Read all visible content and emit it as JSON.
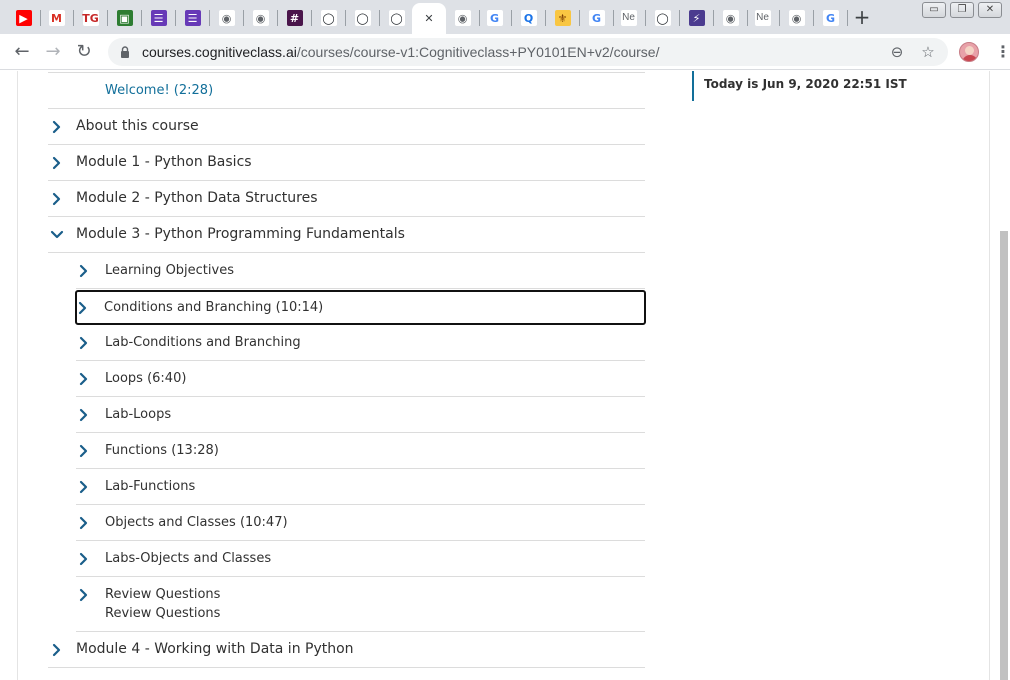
{
  "browser": {
    "tabs": [
      {
        "icon": "youtube-icon",
        "glyph": "▶",
        "color": "#ff0000",
        "text_color": "#ffffff"
      },
      {
        "icon": "gmail-icon",
        "glyph": "M",
        "color": "#ffffff",
        "text_color": "#d93025"
      },
      {
        "icon": "tg-icon",
        "glyph": "TG",
        "color": "#ffffff",
        "text_color": "#c62828"
      },
      {
        "icon": "contacts-icon",
        "glyph": "▣",
        "color": "#2e7d32",
        "text_color": "#ffffff"
      },
      {
        "icon": "forms-icon",
        "glyph": "☰",
        "color": "#673ab7",
        "text_color": "#ffffff"
      },
      {
        "icon": "forms-icon",
        "glyph": "☰",
        "color": "#673ab7",
        "text_color": "#ffffff"
      },
      {
        "icon": "globe-icon",
        "glyph": "◉",
        "color": "#ffffff",
        "text_color": "#5f6368"
      },
      {
        "icon": "globe-icon",
        "glyph": "◉",
        "color": "#ffffff",
        "text_color": "#5f6368"
      },
      {
        "icon": "slack-icon",
        "glyph": "#",
        "color": "#4a154b",
        "text_color": "#ffffff"
      },
      {
        "icon": "github-icon",
        "glyph": "◯",
        "color": "#ffffff",
        "text_color": "#24292e"
      },
      {
        "icon": "github-icon",
        "glyph": "◯",
        "color": "#ffffff",
        "text_color": "#24292e"
      },
      {
        "icon": "github-icon",
        "glyph": "◯",
        "color": "#ffffff",
        "text_color": "#24292e"
      },
      {
        "icon": "close-icon",
        "glyph": "✕",
        "color": "#ffffff",
        "text_color": "#3c4043",
        "active": true
      },
      {
        "icon": "globe-icon",
        "glyph": "◉",
        "color": "#ffffff",
        "text_color": "#5f6368"
      },
      {
        "icon": "google-icon",
        "glyph": "G",
        "color": "#ffffff",
        "text_color": "#4285f4"
      },
      {
        "icon": "quora-icon",
        "glyph": "Q",
        "color": "#ffffff",
        "text_color": "#1a73e8"
      },
      {
        "icon": "badge-icon",
        "glyph": "⚜",
        "color": "#f9c642",
        "text_color": "#7a3b00"
      },
      {
        "icon": "google-icon",
        "glyph": "G",
        "color": "#ffffff",
        "text_color": "#4285f4"
      },
      {
        "icon": "new-tab-icon",
        "text": "Ne",
        "color": "#ffffff",
        "text_color": "#5f6368"
      },
      {
        "icon": "github-icon",
        "glyph": "◯",
        "color": "#ffffff",
        "text_color": "#24292e"
      },
      {
        "icon": "lightning-icon",
        "glyph": "⚡",
        "color": "#4b3b8f",
        "text_color": "#ffffff"
      },
      {
        "icon": "globe-icon",
        "glyph": "◉",
        "color": "#ffffff",
        "text_color": "#5f6368"
      },
      {
        "icon": "new-tab-icon",
        "text": "Ne",
        "color": "#ffffff",
        "text_color": "#5f6368"
      },
      {
        "icon": "globe-icon",
        "glyph": "◉",
        "color": "#ffffff",
        "text_color": "#5f6368"
      },
      {
        "icon": "google-icon",
        "glyph": "G",
        "color": "#ffffff",
        "text_color": "#4285f4"
      }
    ],
    "new_tab_glyph": "+",
    "window_controls": {
      "minimize": "▭",
      "restore": "❐",
      "close": "✕"
    },
    "nav": {
      "back": "←",
      "forward": "→",
      "reload": "↻"
    },
    "url_host": "courses.cognitiveclass.ai",
    "url_path": "/courses/course-v1:Cognitiveclass+PY0101EN+v2/course/",
    "zoom_glyph": "⊖",
    "star_glyph": "☆",
    "menu_glyph": "⋮"
  },
  "course": {
    "welcome_link": "Welcome! (2:28)",
    "sections": [
      {
        "label": "About this course",
        "expanded": false
      },
      {
        "label": "Module 1 - Python Basics",
        "expanded": false
      },
      {
        "label": "Module 2 - Python Data Structures",
        "expanded": false
      },
      {
        "label": "Module 3 - Python Programming Fundamentals",
        "expanded": true
      },
      {
        "label": "Module 4 - Working with Data in Python",
        "expanded": false
      }
    ],
    "subsections": [
      {
        "label": "Learning Objectives"
      },
      {
        "label": "Conditions and Branching (10:14)",
        "focused": true
      },
      {
        "label": "Lab-Conditions and Branching"
      },
      {
        "label": "Loops (6:40)"
      },
      {
        "label": "Lab-Loops"
      },
      {
        "label": "Functions (13:28)"
      },
      {
        "label": "Lab-Functions"
      },
      {
        "label": "Objects and Classes (10:47)"
      },
      {
        "label": "Labs-Objects and Classes"
      },
      {
        "label": "Review Questions",
        "sublabel": "Review Questions"
      }
    ],
    "date_text": "Today is Jun 9, 2020 22:51 IST",
    "accent_color": "#126f9a",
    "chevron_color": "#1a5e8a"
  }
}
